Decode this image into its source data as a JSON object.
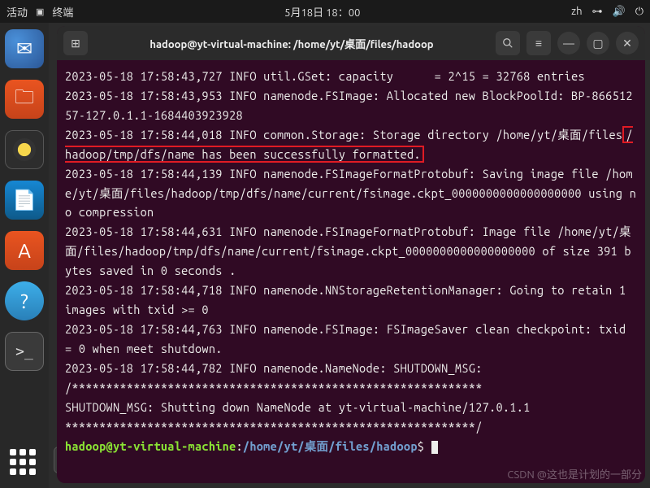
{
  "topbar": {
    "activities": "活动",
    "app": "终端",
    "datetime": "5月18日 18：00",
    "lang": "zh"
  },
  "dock_tooltip": "显示应用程序",
  "window": {
    "title": "hadoop@yt-virtual-machine: /home/yt/桌面/files/hadoop"
  },
  "terminal": {
    "l1": "2023-05-18 17:58:43,727 INFO util.GSet: capacity      = 2^15 = 32768 entries",
    "l2": "2023-05-18 17:58:43,953 INFO namenode.FSImage: Allocated new BlockPoolId: BP-86651257-127.0.1.1-1684403923928",
    "l3a": "2023-05-18 17:58:44,018 INFO common.Storage: Storage directory /home/yt/桌面/files",
    "l3b": "/hadoop/tmp/dfs/name has been successfully formatted.",
    "l4": "2023-05-18 17:58:44,139 INFO namenode.FSImageFormatProtobuf: Saving image file /home/yt/桌面/files/hadoop/tmp/dfs/name/current/fsimage.ckpt_0000000000000000000 using no compression",
    "l5": "2023-05-18 17:58:44,631 INFO namenode.FSImageFormatProtobuf: Image file /home/yt/桌面/files/hadoop/tmp/dfs/name/current/fsimage.ckpt_0000000000000000000 of size 391 bytes saved in 0 seconds .",
    "l6": "2023-05-18 17:58:44,718 INFO namenode.NNStorageRetentionManager: Going to retain 1 images with txid >= 0",
    "l7": "2023-05-18 17:58:44,763 INFO namenode.FSImage: FSImageSaver clean checkpoint: txid = 0 when meet shutdown.",
    "l8": "2023-05-18 17:58:44,782 INFO namenode.NameNode: SHUTDOWN_MSG:",
    "l9": "/************************************************************",
    "l10": "SHUTDOWN_MSG: Shutting down NameNode at yt-virtual-machine/127.0.1.1",
    "l11": "************************************************************/",
    "prompt_user": "hadoop@yt-virtual-machine",
    "prompt_colon": ":",
    "prompt_path": "/home/yt/桌面/files/hadoop",
    "prompt_dollar": "$"
  },
  "watermark": "CSDN @这也是计划的一部分"
}
